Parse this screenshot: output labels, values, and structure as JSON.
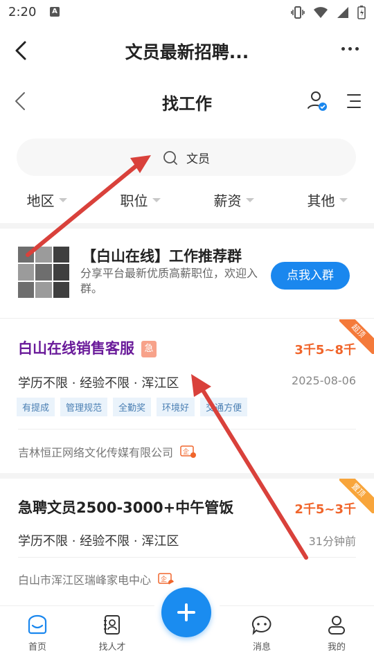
{
  "status_bar": {
    "time": "2:20",
    "notification_icon": "A"
  },
  "app_bar": {
    "title": "文员最新招聘..."
  },
  "sub_header": {
    "title": "找工作"
  },
  "search": {
    "query": "文员"
  },
  "filters": [
    {
      "label": "地区"
    },
    {
      "label": "职位"
    },
    {
      "label": "薪资"
    },
    {
      "label": "其他"
    }
  ],
  "group_card": {
    "title": "【白山在线】工作推荐群",
    "description": "分享平台最新优质高薪职位，欢迎入群。",
    "join_label": "点我入群"
  },
  "jobs": [
    {
      "title": "白山在线销售客服",
      "urgent_label": "急",
      "salary": "3千5~8千",
      "meta": "学历不限 · 经验不限 · 浑江区",
      "date": "2025-08-06",
      "tags": [
        "有提成",
        "管理规范",
        "全勤奖",
        "环境好",
        "交通方便"
      ],
      "company": "吉林恒正网络文化传媒有限公司",
      "badge": "超顶",
      "badge_color": "#f47a3a",
      "title_color": "#6a1b9a"
    },
    {
      "title": "急聘文员2500-3000+中午管饭",
      "salary": "2千5~3千",
      "meta": "学历不限 · 经验不限 · 浑江区",
      "date": "31分钟前",
      "company": "白山市浑江区瑞峰家电中心",
      "badge": "置顶",
      "badge_color": "#f8a53b",
      "title_color": "#222222"
    }
  ],
  "tab_bar": {
    "tabs": [
      {
        "label": "首页",
        "icon": "home-icon"
      },
      {
        "label": "找人才",
        "icon": "contacts-icon"
      },
      {
        "label": "消息",
        "icon": "message-icon"
      },
      {
        "label": "我的",
        "icon": "profile-icon"
      }
    ]
  },
  "colors": {
    "accent": "#1a87ee",
    "salary": "#f0652b",
    "annotation_arrow": "#d9413b"
  }
}
